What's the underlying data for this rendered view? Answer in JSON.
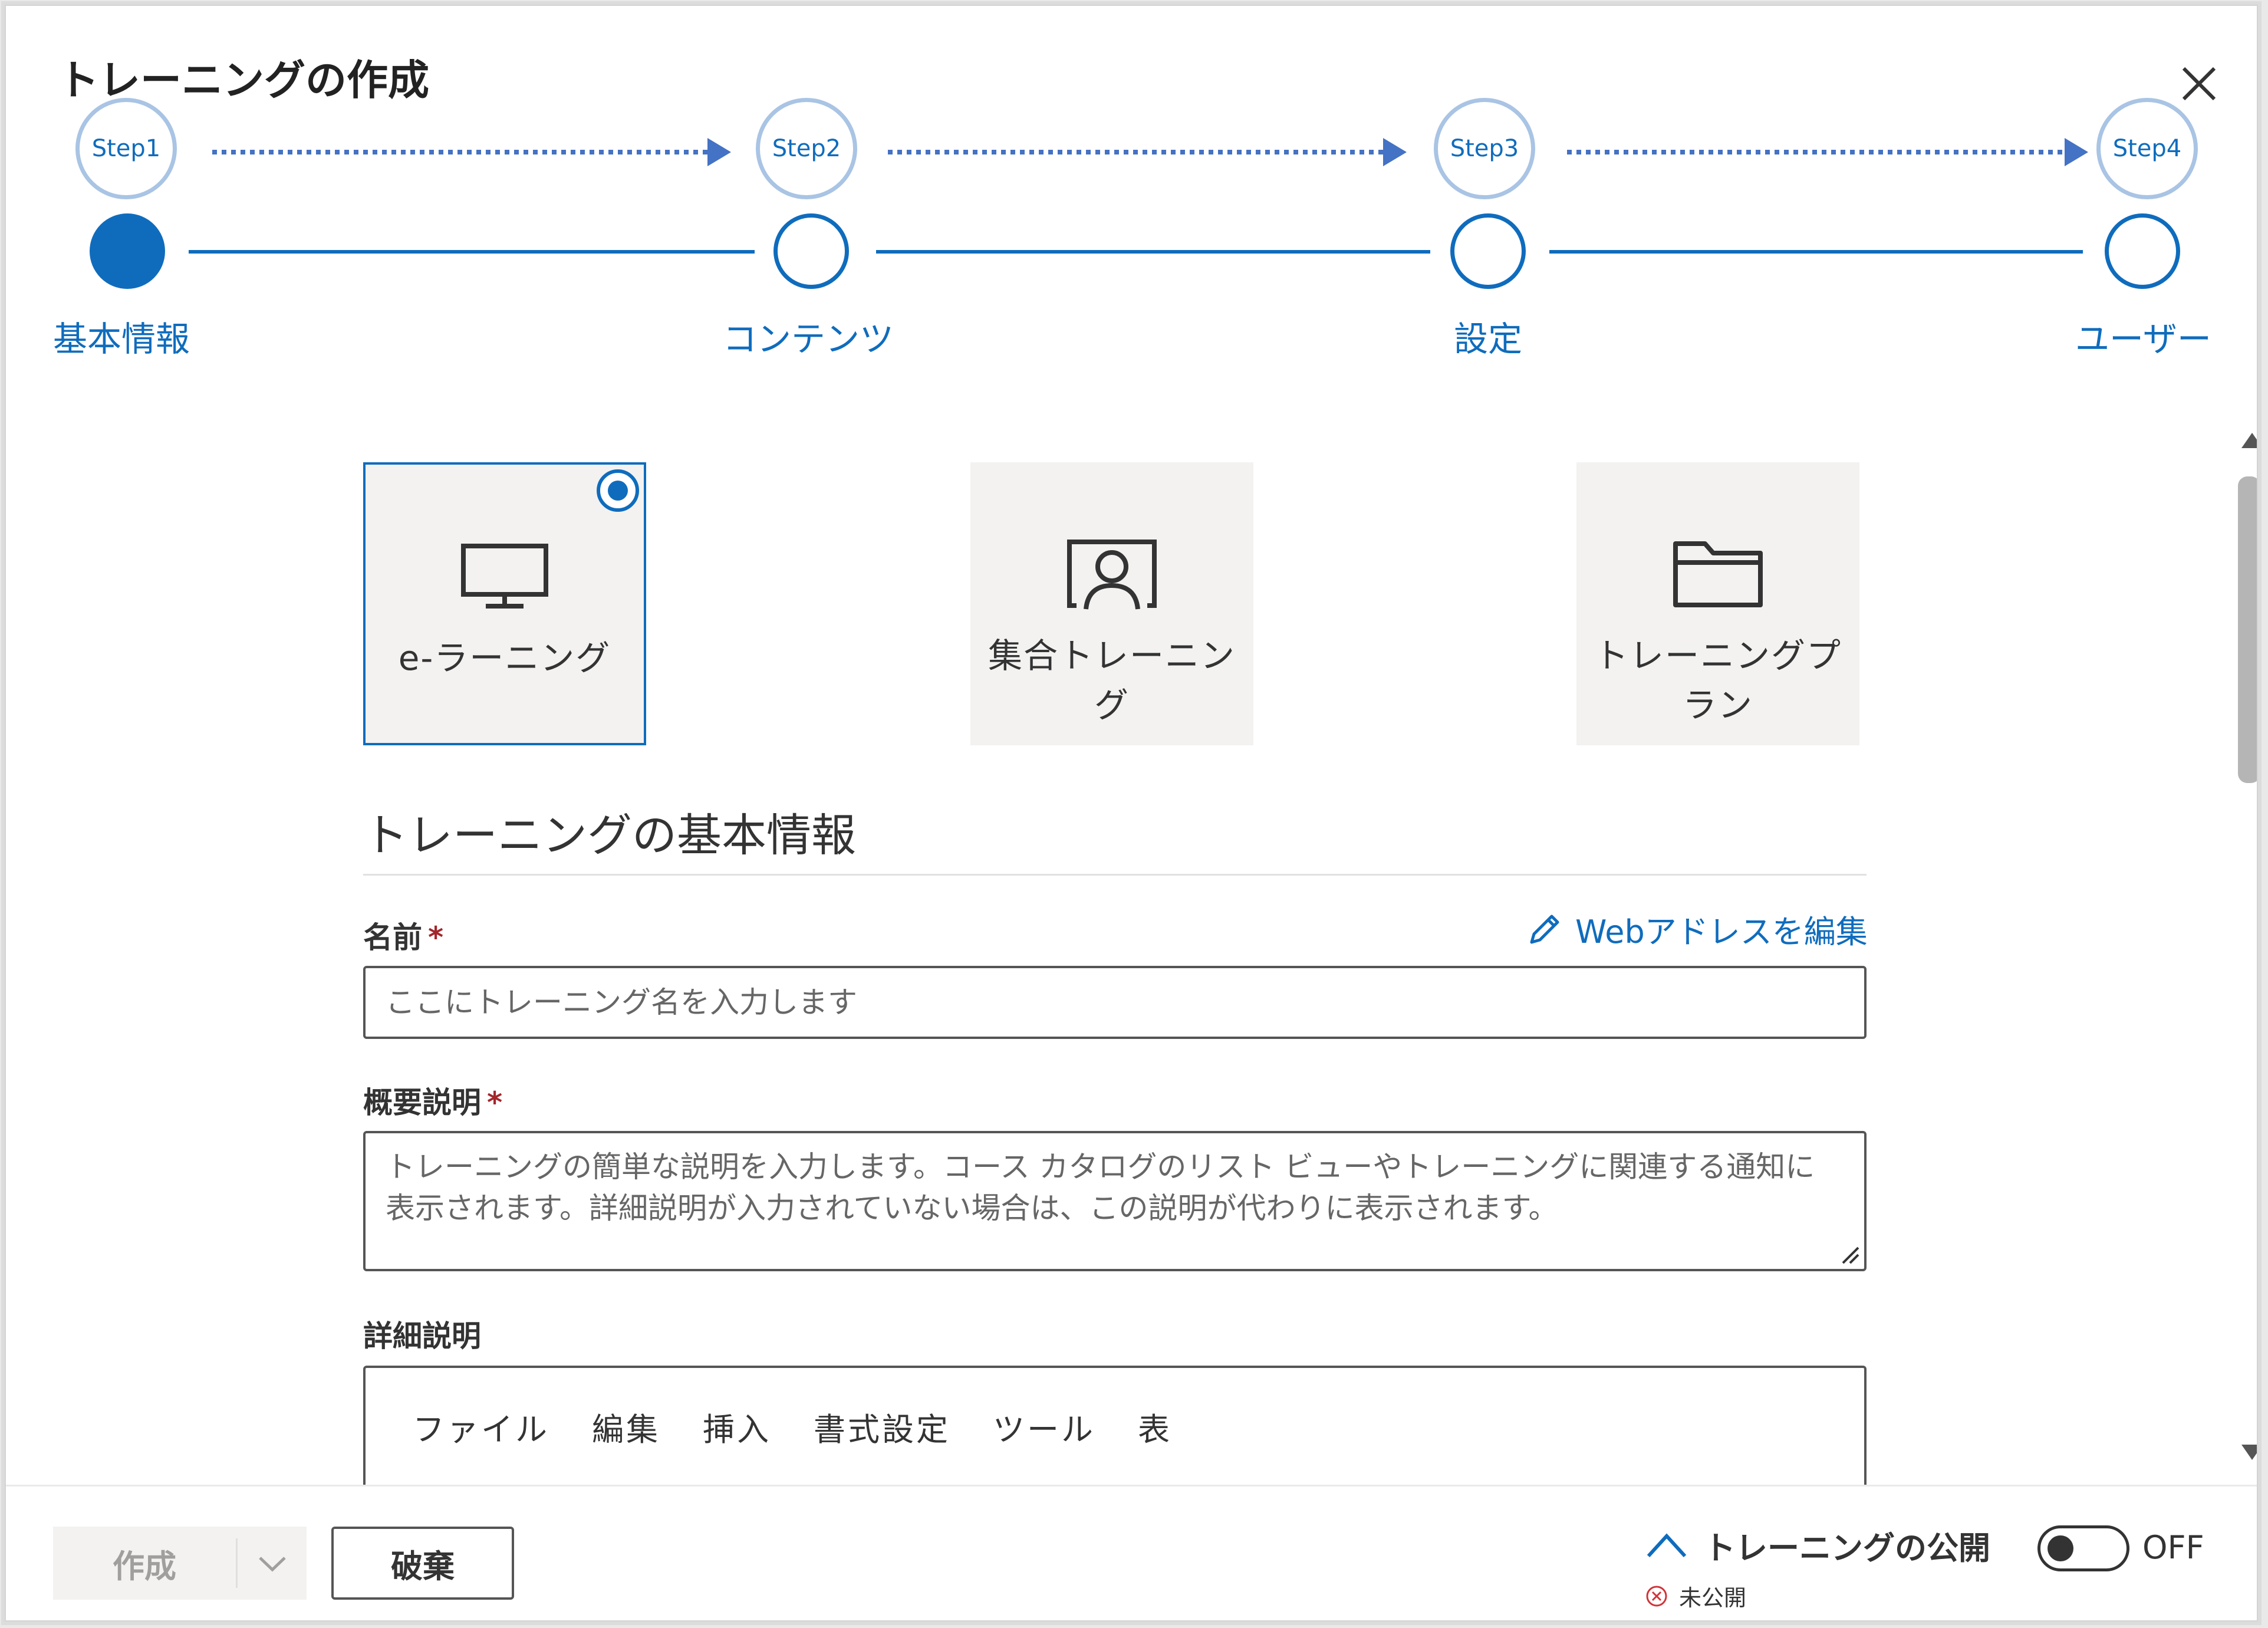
{
  "dialog": {
    "title": "トレーニングの作成"
  },
  "steps": [
    {
      "bubble": "Step1",
      "label": "基本情報",
      "state": "current"
    },
    {
      "bubble": "Step2",
      "label": "コンテンツ",
      "state": "pending"
    },
    {
      "bubble": "Step3",
      "label": "設定",
      "state": "pending"
    },
    {
      "bubble": "Step4",
      "label": "ユーザー",
      "state": "pending"
    }
  ],
  "training_types": [
    {
      "label": "e-ラーニング",
      "icon": "monitor-icon",
      "selected": true
    },
    {
      "label": "集合トレーニング",
      "icon": "classroom-presenter-icon",
      "selected": false
    },
    {
      "label": "トレーニングプラン",
      "icon": "folder-icon",
      "selected": false
    }
  ],
  "basic_info": {
    "section_title": "トレーニングの基本情報",
    "name_label": "名前",
    "required_mark": "*",
    "edit_web_address": "Webアドレスを編集",
    "name_placeholder": "ここにトレーニング名を入力します",
    "summary_label": "概要説明",
    "summary_placeholder": "トレーニングの簡単な説明を入力します。コース カタログのリスト ビューやトレーニングに関連する通知に表示されます。詳細説明が入力されていない場合は、この説明が代わりに表示されます。",
    "detail_label": "詳細説明",
    "editor_menu": [
      "ファイル",
      "編集",
      "挿入",
      "書式設定",
      "ツール",
      "表"
    ]
  },
  "footer": {
    "create_label": "作成",
    "create_enabled": false,
    "discard_label": "破棄",
    "publish_label": "トレーニングの公開",
    "publish_status": "未公開",
    "toggle_state": "OFF",
    "toggle_on": false
  },
  "colors": {
    "accent": "#0f6cbd",
    "step_bubble_border": "#a9c4e4",
    "card_bg": "#f3f2f1",
    "required": "#a4262c"
  }
}
